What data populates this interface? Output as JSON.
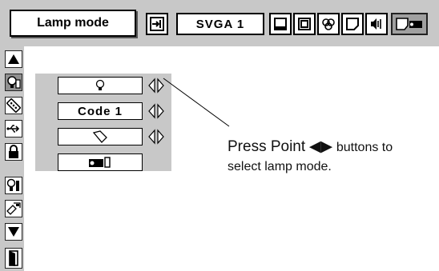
{
  "toolbar": {
    "menu_title": "Lamp mode",
    "input_mode": "SVGA 1",
    "icons": [
      "input-icon",
      "pc-adjust-icon",
      "image-select-icon",
      "color-adjust-icon",
      "screen-icon",
      "sound-icon",
      "lamp-mode-icon"
    ]
  },
  "sidebar": {
    "items": [
      "up-arrow-icon",
      "lamp-mode-icon",
      "remote-control-icon",
      "usb-icon",
      "lock-icon",
      "lamp-counter-icon",
      "setting-icon",
      "down-arrow-icon",
      "exit-icon"
    ],
    "selected": "lamp-mode-icon"
  },
  "options": [
    {
      "name": "lamp-mode",
      "value_icon": "lamp-bulb-icon"
    },
    {
      "name": "remote-control",
      "value": "Code 1"
    },
    {
      "name": "pointer",
      "value_icon": "pointer-icon"
    },
    {
      "name": "lamp-counter",
      "value_icon": "projector-icon"
    }
  ],
  "instruction": {
    "line1_prefix": "Press Point",
    "arrows": "◀▶",
    "line1_suffix": "buttons to",
    "line2": "select lamp mode."
  }
}
